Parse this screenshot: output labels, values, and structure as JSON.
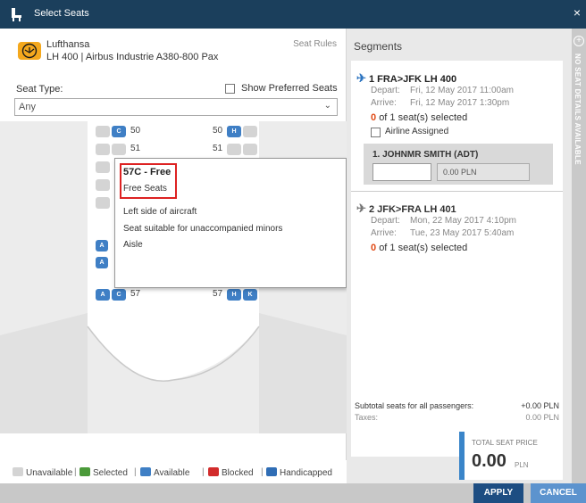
{
  "window": {
    "title": "Select Seats",
    "close_glyph": "×"
  },
  "flight": {
    "airline": "Lufthansa",
    "info": "LH 400 | Airbus Industrie A380-800 Pax",
    "seat_rules": "Seat Rules"
  },
  "filters": {
    "seat_type_label": "Seat Type:",
    "seat_type_value": "Any",
    "show_preferred_label": "Show Preferred Seats",
    "show_preferred_checked": false
  },
  "seat_map": {
    "rows": [
      {
        "left_number": "50",
        "right_number": "50"
      },
      {
        "left_number": "51",
        "right_number": "51"
      },
      {
        "left_number": "57",
        "right_number": "57"
      }
    ],
    "seat_letters": {
      "row50_left": "C",
      "row50_right": "H",
      "row57_left_a": "A",
      "row57_left_c": "C",
      "row57_right_h": "H",
      "row57_right_k": "K",
      "row56_left": "A",
      "row55_left": "A"
    }
  },
  "tooltip": {
    "seat_title": "57C - Free",
    "seat_group": "Free Seats",
    "features": [
      "Left side of aircraft",
      "Seat suitable for unaccompanied minors",
      "Aisle"
    ]
  },
  "legend": {
    "items": [
      {
        "label": "Unavailable",
        "color": "#d4d4d4"
      },
      {
        "label": "Selected",
        "color": "#4b9a3a"
      },
      {
        "label": "Available",
        "color": "#3f7fc5"
      },
      {
        "label": "Blocked",
        "color": "#d22b2b"
      },
      {
        "label": "Handicapped",
        "color": "#2f6db5"
      }
    ]
  },
  "segments": {
    "title": "Segments",
    "list": [
      {
        "route": "1 FRA>JFK LH 400",
        "depart_label": "Depart:",
        "depart": "Fri, 12 May 2017 11:00am",
        "arrive_label": "Arrive:",
        "arrive": "Fri, 12 May 2017 1:30pm",
        "selected_count": "0",
        "selected_text": "of 1 seat(s) selected",
        "airline_assigned_label": "Airline Assigned",
        "passenger": "1. JOHNMR SMITH (ADT)",
        "passenger_price": "0.00 PLN"
      },
      {
        "route": "2 JFK>FRA LH 401",
        "depart_label": "Depart:",
        "depart": "Mon, 22 May 2017 4:10pm",
        "arrive_label": "Arrive:",
        "arrive": "Tue, 23 May 2017 5:40am",
        "selected_count": "0",
        "selected_text": "of 1 seat(s) selected"
      }
    ],
    "subtotal_label": "Subtotal seats for all passengers:",
    "subtotal_value": "+0.00 PLN",
    "taxes_label": "Taxes:",
    "taxes_value": "0.00 PLN"
  },
  "total": {
    "label": "TOTAL SEAT PRICE",
    "amount": "0.00",
    "currency": "PLN"
  },
  "sidebar": {
    "text": "NO SEAT DETAILS AVAILABLE"
  },
  "buttons": {
    "apply": "APPLY",
    "cancel": "CANCEL"
  },
  "colors": {
    "titlebar": "#1b3f5c",
    "accent": "#3a85c9",
    "apply": "#1d4d82",
    "cancel": "#5c93ce",
    "highlight": "#d22222",
    "count": "#e04a15"
  }
}
